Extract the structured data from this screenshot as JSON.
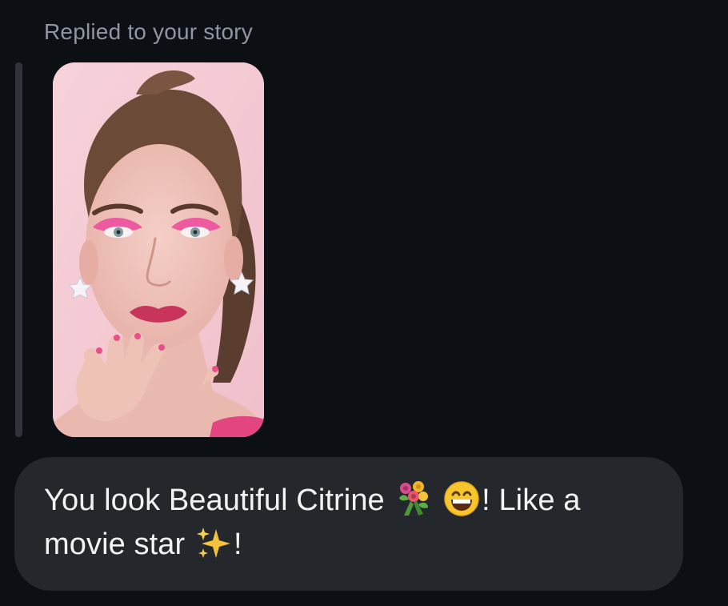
{
  "reply": {
    "label": "Replied to your story"
  },
  "story": {
    "media": "photo"
  },
  "message": {
    "part1": "You look Beautiful Citrine ",
    "emoji1": "bouquet-emoji",
    "emoji2": "grinning-face-emoji",
    "part2": "! Like a movie star ",
    "emoji3": "sparkles-emoji",
    "part3": "!"
  },
  "colors": {
    "background": "#0c0f14",
    "bubble": "#24272c",
    "label_text": "#8f96a2",
    "message_text": "#f2f3f5",
    "quote_bar": "#2f343b"
  }
}
